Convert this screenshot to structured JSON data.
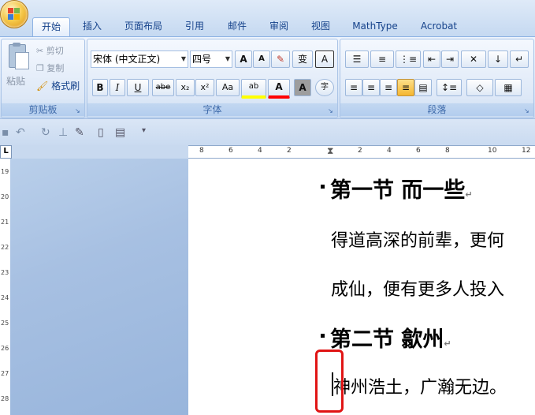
{
  "tabs": [
    "开始",
    "插入",
    "页面布局",
    "引用",
    "邮件",
    "审阅",
    "视图",
    "MathType",
    "Acrobat"
  ],
  "clipboard": {
    "paste": "粘贴",
    "cut": "剪切",
    "copy": "复制",
    "format_painter": "格式刷",
    "label": "剪贴板"
  },
  "font": {
    "name": "宋体 (中文正文)",
    "size": "四号",
    "label": "字体",
    "grow": "A",
    "shrink": "A",
    "bold": "B",
    "italic": "I",
    "underline": "U",
    "strike": "abe",
    "subscript": "x₂",
    "superscript": "x²",
    "change_case": "Aa",
    "highlight": "ab",
    "font_color": "A",
    "char_shading": "A",
    "phonetic": "变",
    "char_border": "A",
    "enclose": "字"
  },
  "paragraph": {
    "label": "段落"
  },
  "ruler": {
    "corner": "L",
    "ticks": [
      "8",
      "6",
      "4",
      "2",
      "2",
      "4",
      "6",
      "8",
      "10",
      "12"
    ]
  },
  "vruler_ticks": [
    "19",
    "20",
    "21",
    "22",
    "23",
    "24",
    "25",
    "26",
    "27",
    "28"
  ],
  "document": {
    "heading1": "第一节 而一些",
    "line1": "得道高深的前辈，更何",
    "line2": "成仙，便有更多人投入",
    "heading2": "第二节 歙州",
    "line3": "神州浩土，广瀚无边。",
    "para_mark": "↵"
  },
  "colors": {
    "highlight": "#ffff00",
    "font_color": "#ff0000",
    "annotation": "#e01414"
  }
}
